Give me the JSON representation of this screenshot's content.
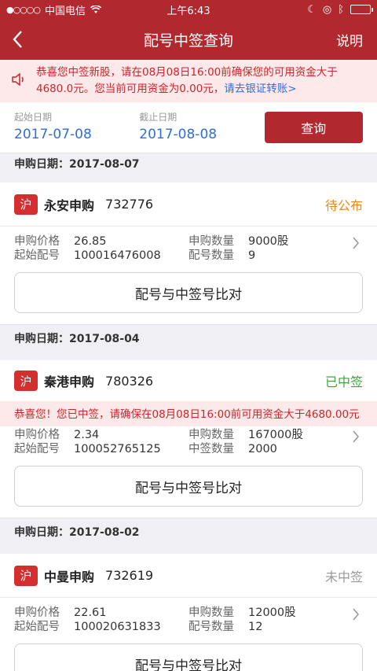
{
  "status": {
    "carrier": "中国电信",
    "time": "上午6:43"
  },
  "nav": {
    "title": "配号中签查询",
    "right": "说明"
  },
  "notice": {
    "text": "恭喜您中签新股，请在08月08日16:00前确保您的可用资金大于4680.0元。您当前可用资金为0.00元，",
    "link": "请去银证转账>"
  },
  "dates": {
    "start_label": "起始日期",
    "start": "2017-07-08",
    "end_label": "截止日期",
    "end": "2017-08-08",
    "query": "查询"
  },
  "labels": {
    "price": "申购价格",
    "qty": "申购数量",
    "start_no": "起始配号",
    "count": "配号数量",
    "win_qty": "中签数量",
    "compare": "配号与中签号比对"
  },
  "groups": [
    {
      "header": "申购日期：2017-08-07",
      "market": "沪",
      "name": "永安申购",
      "code": "732776",
      "status": "待公布",
      "status_color": "#ef8a1a",
      "price": "26.85",
      "qty": "9000股",
      "start_no": "100016476008",
      "count_label": "配号数量",
      "count": "9"
    },
    {
      "header": "申购日期：2017-08-04",
      "market": "沪",
      "name": "秦港申购",
      "code": "780326",
      "status": "已中签",
      "status_color": "#3aaa35",
      "notice": "恭喜您！您已中签，请确保在08月08日16:00前可用资金大于4680.00元",
      "price": "2.34",
      "qty": "167000股",
      "start_no": "100052765125",
      "count_label": "中签数量",
      "count": "2000"
    },
    {
      "header": "申购日期：2017-08-02",
      "market": "沪",
      "name": "中曼申购",
      "code": "732619",
      "status": "未中签",
      "status_color": "#999999",
      "price": "22.61",
      "qty": "12000股",
      "start_no": "100020631833",
      "count_label": "配号数量",
      "count": "12"
    }
  ]
}
